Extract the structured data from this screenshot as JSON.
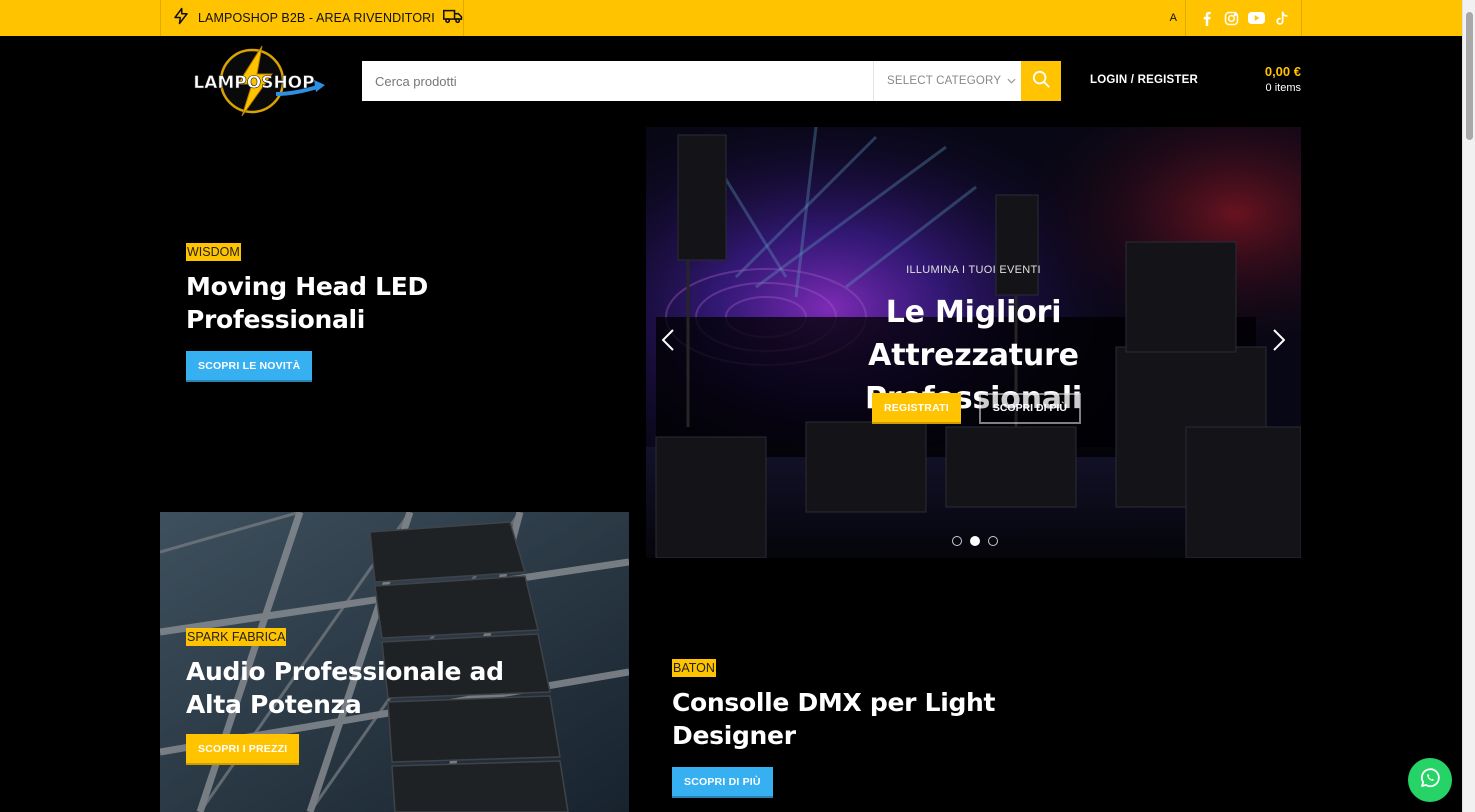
{
  "topbar": {
    "announcement": "LAMPOSHOP B2B - AREA RIVENDITORI",
    "truncated_text": "A",
    "icons": [
      "bolt-icon",
      "truck-icon",
      "facebook-icon",
      "instagram-icon",
      "youtube-icon",
      "tiktok-icon"
    ]
  },
  "header": {
    "logo_text": "LAMPOSHOP",
    "search_placeholder": "Cerca prodotti",
    "category_label": "SELECT CATEGORY",
    "login_label": "LOGIN / REGISTER",
    "cart_price": "0,00 €",
    "cart_items": "0 items"
  },
  "banner_top_left": {
    "tag": "WISDOM",
    "title": "Moving Head LED Professionali",
    "button": "SCOPRI LE NOVITÀ"
  },
  "slider": {
    "kicker": "ILLUMINA I TUOI EVENTI",
    "title": "Le Migliori Attrezzature Professionali",
    "button_primary": "REGISTRATI",
    "button_secondary": "SCOPRI DI PIÙ",
    "active_dot": 2,
    "dot_count": 3
  },
  "banner_bottom_left": {
    "tag": "SPARK FABRICA",
    "title": "Audio Professionale ad Alta Potenza",
    "button": "SCOPRI I PREZZI"
  },
  "banner_bottom_right": {
    "tag": "BATON",
    "title": "Consolle DMX per Light Designer",
    "button": "SCOPRI DI PIÙ"
  },
  "colors": {
    "brand_yellow": "#ffc300",
    "accent_blue": "#37b0f2",
    "background": "#000000",
    "whatsapp_green": "#25d366"
  }
}
